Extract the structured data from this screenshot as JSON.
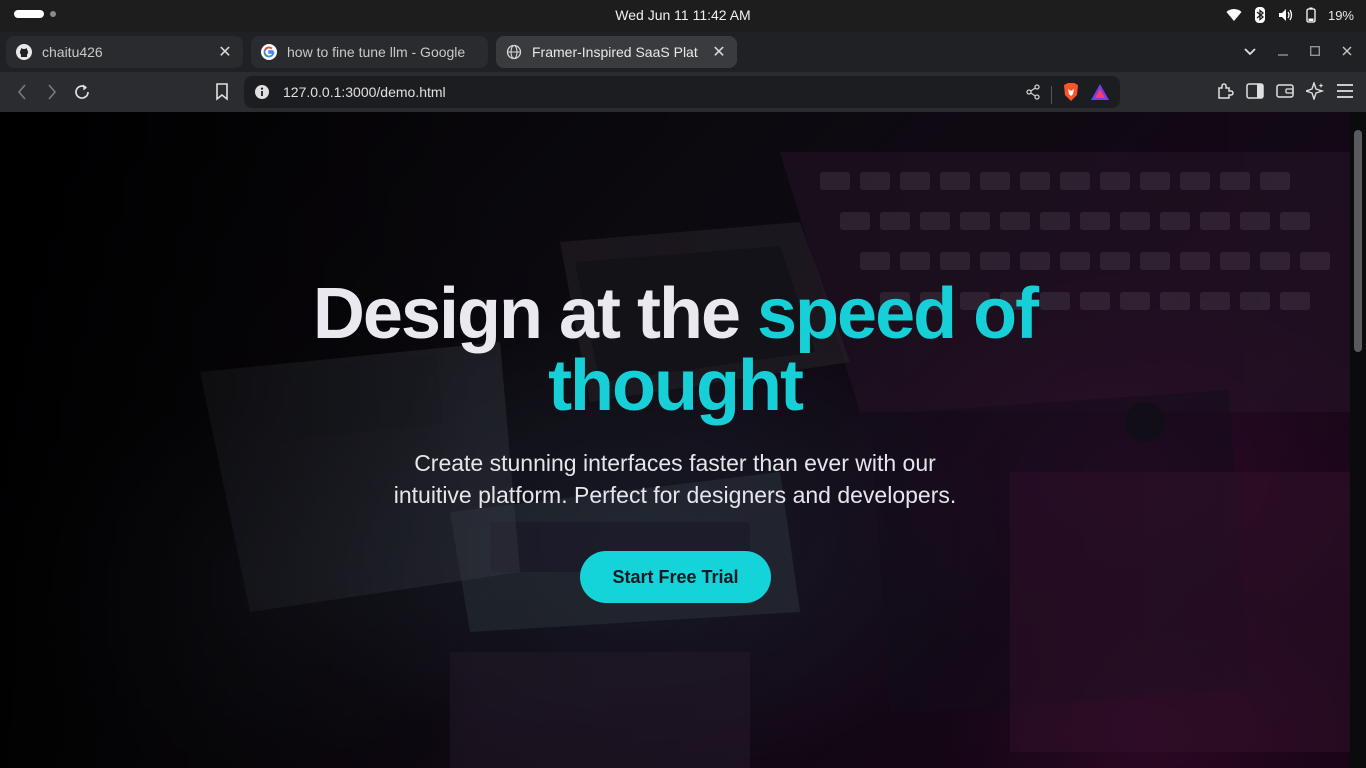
{
  "os": {
    "clock": "Wed Jun 11  11:42 AM",
    "battery": "19%"
  },
  "tabs": [
    {
      "title": "chaitu426",
      "favicon": "github-icon",
      "active": false
    },
    {
      "title": "how to fine tune llm - Google",
      "favicon": "google-icon",
      "active": false
    },
    {
      "title": "Framer-Inspired SaaS Plat",
      "favicon": "globe-icon",
      "active": true
    }
  ],
  "toolbar": {
    "url": "127.0.0.1:3000/demo.html"
  },
  "hero": {
    "title_plain": "Design at the ",
    "title_accent_1": "speed of",
    "title_accent_2": "thought",
    "subtitle_line1": "Create stunning interfaces faster than ever with our",
    "subtitle_line2": "intuitive platform. Perfect for designers and developers.",
    "cta_label": "Start Free Trial"
  },
  "colors": {
    "accent": "#17cfd6",
    "cta_bg": "#14d3d9",
    "tab_active": "#3a3b3f",
    "tab_inactive": "#2a2b2e"
  }
}
